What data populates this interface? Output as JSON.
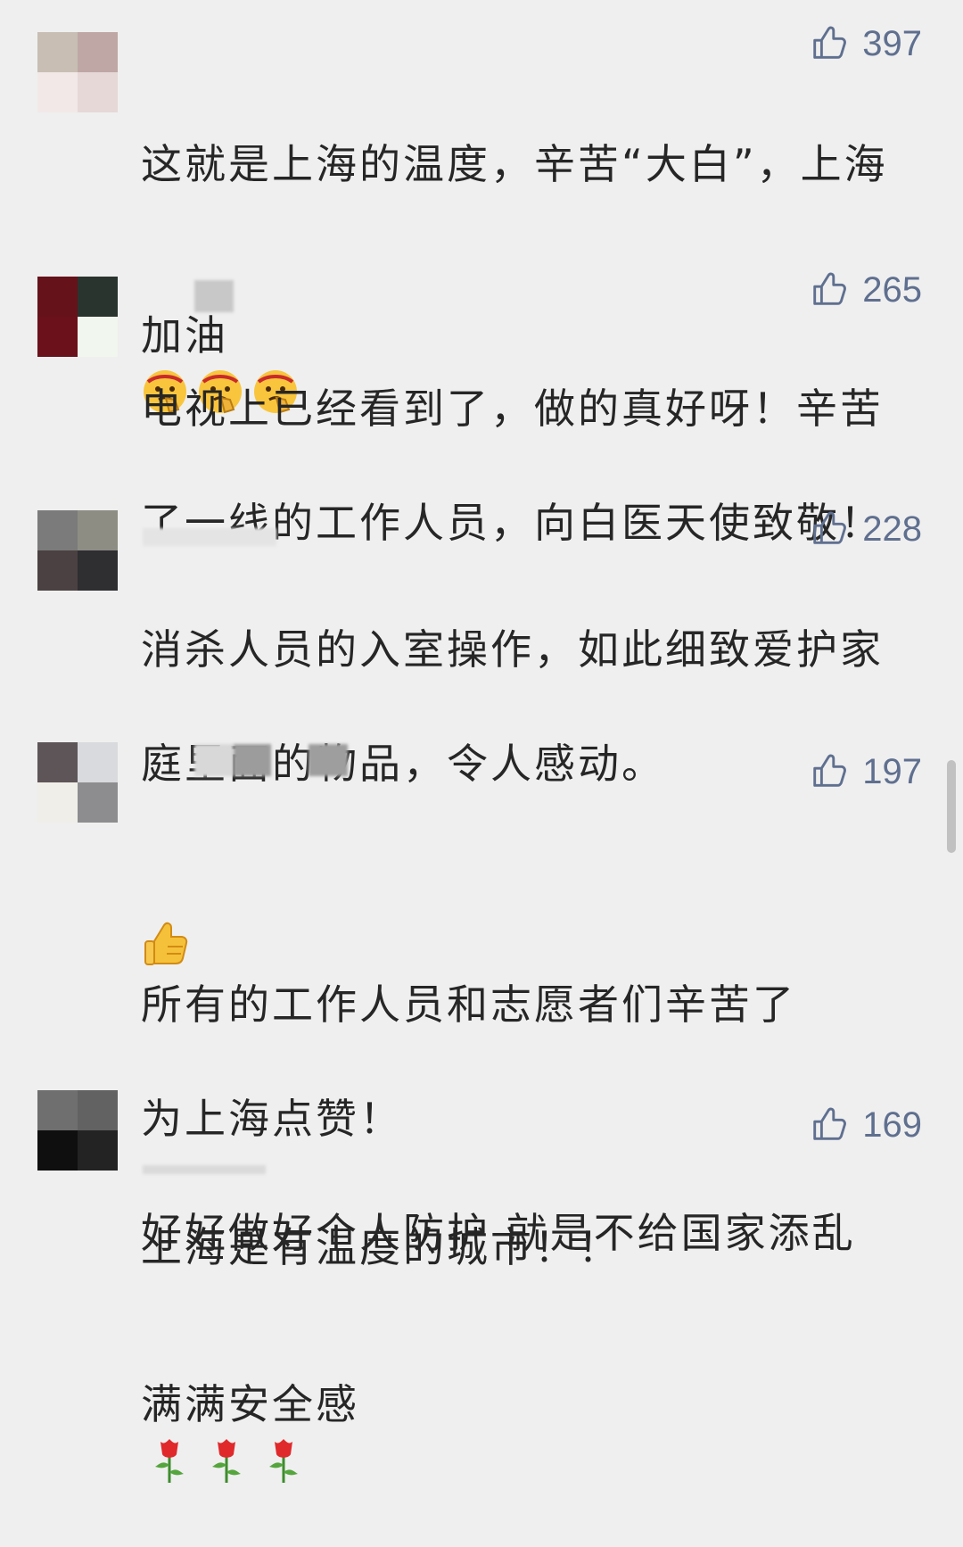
{
  "comments": [
    {
      "likes": "397",
      "text_lines": [
        "这就是上海的温度，辛苦“大白”，上海",
        "加油"
      ],
      "emoji": "salute-face-emoji",
      "avatar_colors": [
        "#c8beb4",
        "#bfa7a5",
        "#f2e8e8",
        "#e6d8d7"
      ]
    },
    {
      "likes": "265",
      "text_lines": [
        "电视上已经看到了，做的真好呀！辛苦",
        "了一线的工作人员，向白医天使致敬！"
      ],
      "avatar_colors": [
        "#65121a",
        "#2a342f",
        "#6b111b",
        "#f1f6ee"
      ]
    },
    {
      "likes": "228",
      "text_lines": [
        "消杀人员的入室操作，如此细致爱护家",
        "庭里面的物品，令人感动。"
      ],
      "avatar_colors": [
        "#7b7b7b",
        "#8d8d84",
        "#4b4142",
        "#2f2e31"
      ]
    },
    {
      "likes": "197",
      "text_lines": [
        "所有的工作人员和志愿者们辛苦了",
        "为上海点赞！",
        "好好做好个人防护 就是不给国家添乱",
        "满满安全感"
      ],
      "emoji": "thumbs-up-emoji",
      "rose": "rose-emoji",
      "avatar_colors": [
        "#5d5558",
        "#d9dadd",
        "#f0eee9",
        "#8d8d90"
      ]
    },
    {
      "likes": "169",
      "text_lines": [
        "上海是有温度的城市！！"
      ],
      "avatar_colors": [
        "#6f6f6f",
        "#626262",
        "#0f0f10",
        "#232323"
      ]
    }
  ],
  "colors": {
    "background": "#efefef",
    "text": "#262626",
    "like": "#5f6f8f"
  }
}
